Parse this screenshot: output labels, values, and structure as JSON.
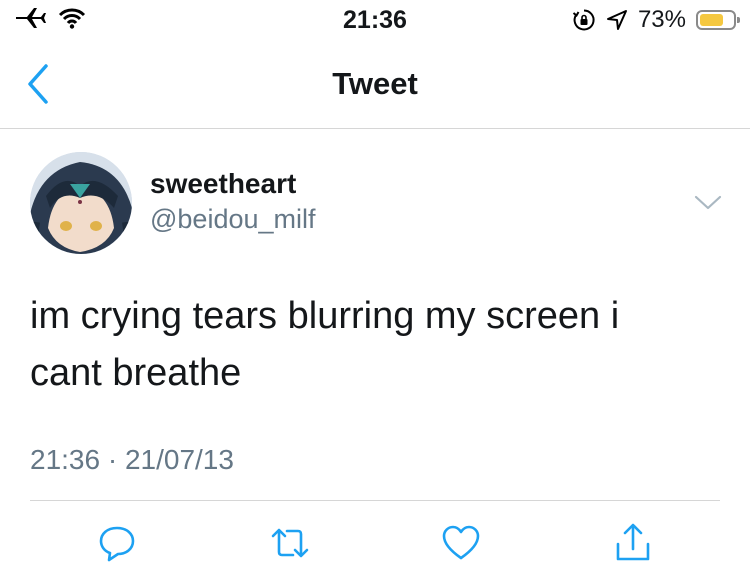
{
  "status_bar": {
    "time": "21:36",
    "battery_percent": "73%",
    "battery_level": 0.73,
    "battery_color": "#f5c840",
    "icons": [
      "airplane-icon",
      "wifi-icon",
      "orientation-lock-icon",
      "location-arrow-icon",
      "battery-icon"
    ]
  },
  "nav": {
    "title": "Tweet",
    "back_icon": "chevron-left-icon",
    "accent_color": "#1da1f2"
  },
  "tweet": {
    "display_name": "sweetheart",
    "handle": "@beidou_milf",
    "text_lines": [
      "im crying tears blurring my screen i",
      "cant breathe"
    ],
    "timestamp": "21:36 · 21/07/13"
  },
  "actions": {
    "icons": [
      "reply-icon",
      "retweet-icon",
      "like-icon",
      "share-icon"
    ],
    "icon_color": "#1da1f2"
  }
}
